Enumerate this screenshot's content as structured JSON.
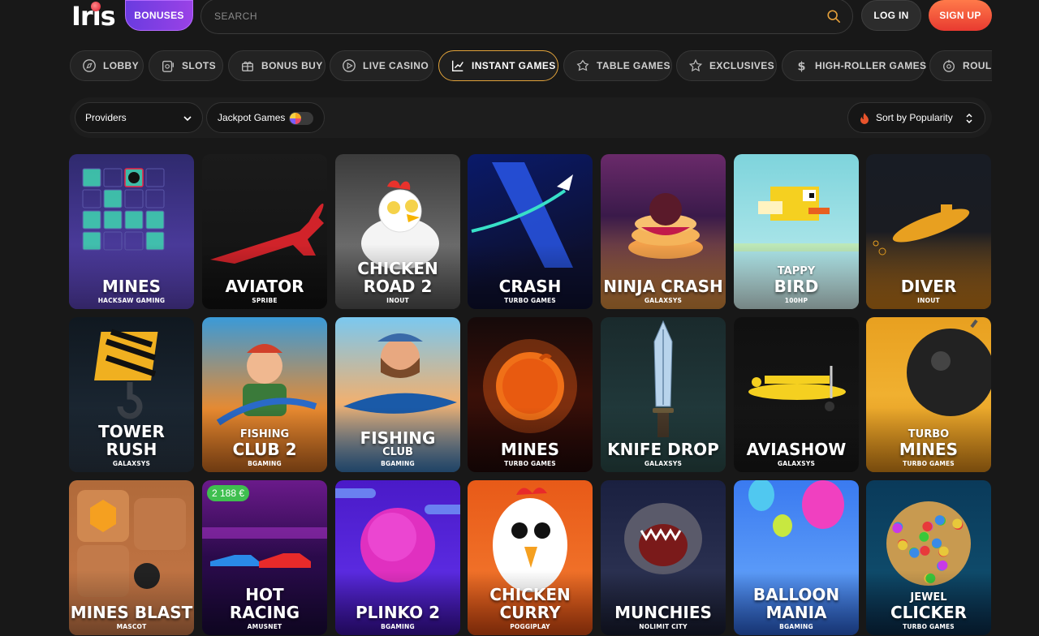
{
  "header": {
    "logo": "Iris",
    "bonuses_label": "BONUSES",
    "search_placeholder": "SEARCH",
    "login_label": "LOG IN",
    "signup_label": "SIGN UP"
  },
  "tabs": [
    {
      "label": "LOBBY",
      "icon": "compass-icon",
      "active": false
    },
    {
      "label": "SLOTS",
      "icon": "slot-machine-icon",
      "active": false
    },
    {
      "label": "BONUS BUY",
      "icon": "gift-icon",
      "active": false
    },
    {
      "label": "LIVE CASINO",
      "icon": "play-circle-icon",
      "active": false
    },
    {
      "label": "INSTANT GAMES",
      "icon": "trend-chart-icon",
      "active": true
    },
    {
      "label": "TABLE GAMES",
      "icon": "cards-icon",
      "active": false
    },
    {
      "label": "EXCLUSIVES",
      "icon": "star-icon",
      "active": false
    },
    {
      "label": "HIGH-ROLLER GAMES",
      "icon": "dollar-icon",
      "active": false
    },
    {
      "label": "ROULE",
      "icon": "roulette-icon",
      "active": false
    }
  ],
  "filters": {
    "providers_label": "Providers",
    "jackpot_label": "Jackpot Games",
    "sort_label": "Sort by Popularity"
  },
  "games": [
    {
      "pre": "",
      "name": "MINES",
      "provider": "HACKSAW GAMING",
      "theme": "mines"
    },
    {
      "pre": "",
      "name": "AVIATOR",
      "provider": "SPRIBE",
      "theme": "aviator"
    },
    {
      "pre": "",
      "name": "CHICKEN\nROAD 2",
      "provider": "INOUT",
      "theme": "chicken"
    },
    {
      "pre": "",
      "name": "CRASH",
      "provider": "TURBO GAMES",
      "theme": "crash"
    },
    {
      "pre": "",
      "name": "NINJA CRASH",
      "provider": "GALAXSYS",
      "theme": "ninja"
    },
    {
      "pre": "TAPPY",
      "name": "BIRD",
      "provider": "100HP",
      "theme": "tappy"
    },
    {
      "pre": "",
      "name": "DIVER",
      "provider": "INOUT",
      "theme": "diver"
    },
    {
      "pre": "",
      "name": "TOWER\nRUSH",
      "provider": "GALAXSYS",
      "theme": "tower"
    },
    {
      "pre": "FISHING",
      "name": "CLUB 2",
      "provider": "BGAMING",
      "theme": "fishing2"
    },
    {
      "pre": "",
      "name": "FISHING",
      "provider": "BGAMING",
      "sub": "CLUB",
      "theme": "fishing"
    },
    {
      "pre": "",
      "name": "MINES",
      "provider": "TURBO GAMES",
      "theme": "mines2"
    },
    {
      "pre": "",
      "name": "KNIFE DROP",
      "provider": "GALAXSYS",
      "theme": "knife"
    },
    {
      "pre": "",
      "name": "AVIASHOW",
      "provider": "GALAXSYS",
      "theme": "aviashow"
    },
    {
      "pre": "TURBO",
      "name": "MINES",
      "provider": "TURBO GAMES",
      "theme": "turbomines"
    },
    {
      "pre": "",
      "name": "MINES BLAST",
      "provider": "MASCOT",
      "theme": "blast"
    },
    {
      "pre": "",
      "name": "HOT\nRACING",
      "provider": "AMUSNET",
      "theme": "racing",
      "badge": "2 188 €"
    },
    {
      "pre": "",
      "name": "PLINKO 2",
      "provider": "BGAMING",
      "theme": "plinko"
    },
    {
      "pre": "",
      "name": "CHICKEN\nCURRY",
      "provider": "POGGIPLAY",
      "theme": "curry"
    },
    {
      "pre": "",
      "name": "MUNCHIES",
      "provider": "NOLIMIT CITY",
      "theme": "munchies"
    },
    {
      "pre": "",
      "name": "BALLOON\nMANIA",
      "provider": "BGAMING",
      "theme": "balloon"
    },
    {
      "pre": "JEWEL",
      "name": "CLICKER",
      "provider": "TURBO GAMES",
      "theme": "jewel"
    }
  ]
}
